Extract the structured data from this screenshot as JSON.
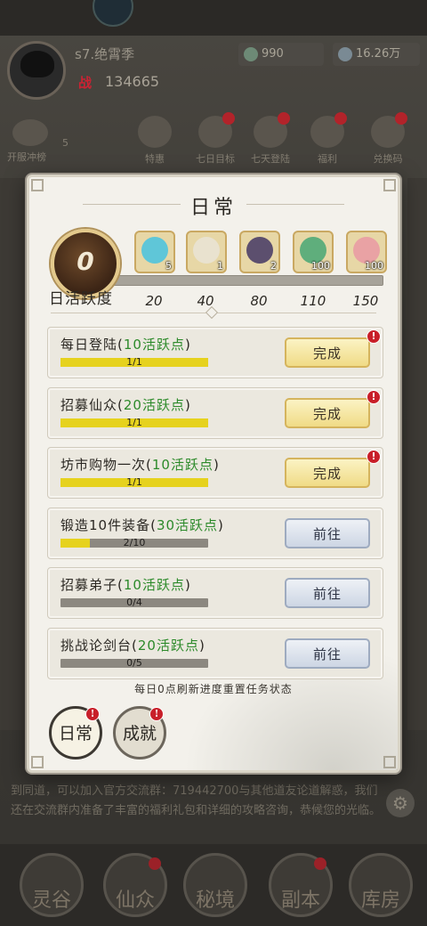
{
  "background": {
    "player": {
      "server": "s7.绝霄季",
      "power_badge": "战",
      "power": "134665",
      "res1": "990",
      "res2": "16.26万"
    },
    "icon_row": [
      {
        "label": "特惠",
        "dot": false
      },
      {
        "label": "七日目标",
        "dot": true
      },
      {
        "label": "七天登陆",
        "dot": true
      },
      {
        "label": "福利",
        "dot": true
      },
      {
        "label": "兑换码",
        "dot": true
      }
    ],
    "left_banner": "开服冲榜",
    "left_banner_count": "5",
    "notice": "到同道，可以加入官方交流群：719442700与其他道友论道解惑，我们还在交流群内准备了丰富的福利礼包和详细的攻略咨询，恭候您的光临。",
    "nav": [
      {
        "label": "灵谷",
        "dot": false
      },
      {
        "label": "仙众",
        "dot": true
      },
      {
        "label": "秘境",
        "dot": false
      },
      {
        "label": "副本",
        "dot": true
      },
      {
        "label": "库房",
        "dot": false
      }
    ]
  },
  "modal": {
    "title": "日常",
    "activity": {
      "value": "0",
      "label": "日活跃度",
      "progress": 0,
      "thresholds": [
        "20",
        "40",
        "80",
        "110",
        "150"
      ],
      "rewards": [
        {
          "icon": "jade-token-icon",
          "count": "5",
          "color": "#5fc6d8"
        },
        {
          "icon": "scroll-icon",
          "count": "1",
          "color": "#e9e2cf"
        },
        {
          "icon": "pouch-icon",
          "count": "2",
          "color": "#5c4f6e"
        },
        {
          "icon": "jade-dragon-icon",
          "count": "100",
          "color": "#5fae7c"
        },
        {
          "icon": "spirit-orb-icon",
          "count": "100",
          "color": "#e9a2a4"
        }
      ]
    },
    "tasks": [
      {
        "name": "每日登陆",
        "points": "10活跃点",
        "current": 1,
        "total": 1,
        "progress_text": "1/1",
        "button": "完成",
        "state": "done",
        "dot": true
      },
      {
        "name": "招募仙众",
        "points": "20活跃点",
        "current": 1,
        "total": 1,
        "progress_text": "1/1",
        "button": "完成",
        "state": "done",
        "dot": true
      },
      {
        "name": "坊市购物一次",
        "points": "10活跃点",
        "current": 1,
        "total": 1,
        "progress_text": "1/1",
        "button": "完成",
        "state": "done",
        "dot": true
      },
      {
        "name": "锻造10件装备",
        "points": "30活跃点",
        "current": 2,
        "total": 10,
        "progress_text": "2/10",
        "button": "前往",
        "state": "go",
        "dot": false
      },
      {
        "name": "招募弟子",
        "points": "10活跃点",
        "current": 0,
        "total": 4,
        "progress_text": "0/4",
        "button": "前往",
        "state": "go",
        "dot": false
      },
      {
        "name": "挑战论剑台",
        "points": "20活跃点",
        "current": 0,
        "total": 5,
        "progress_text": "0/5",
        "button": "前往",
        "state": "go",
        "dot": false
      }
    ],
    "footnote": "每日0点刷新进度重置任务状态",
    "tabs": [
      {
        "label": "日常",
        "dot": true
      },
      {
        "label": "成就",
        "dot": true
      }
    ]
  },
  "colors": {
    "points_green": "#2c8a2a",
    "progress_yellow": "#e6d21e",
    "alert_red": "#c81f29"
  }
}
